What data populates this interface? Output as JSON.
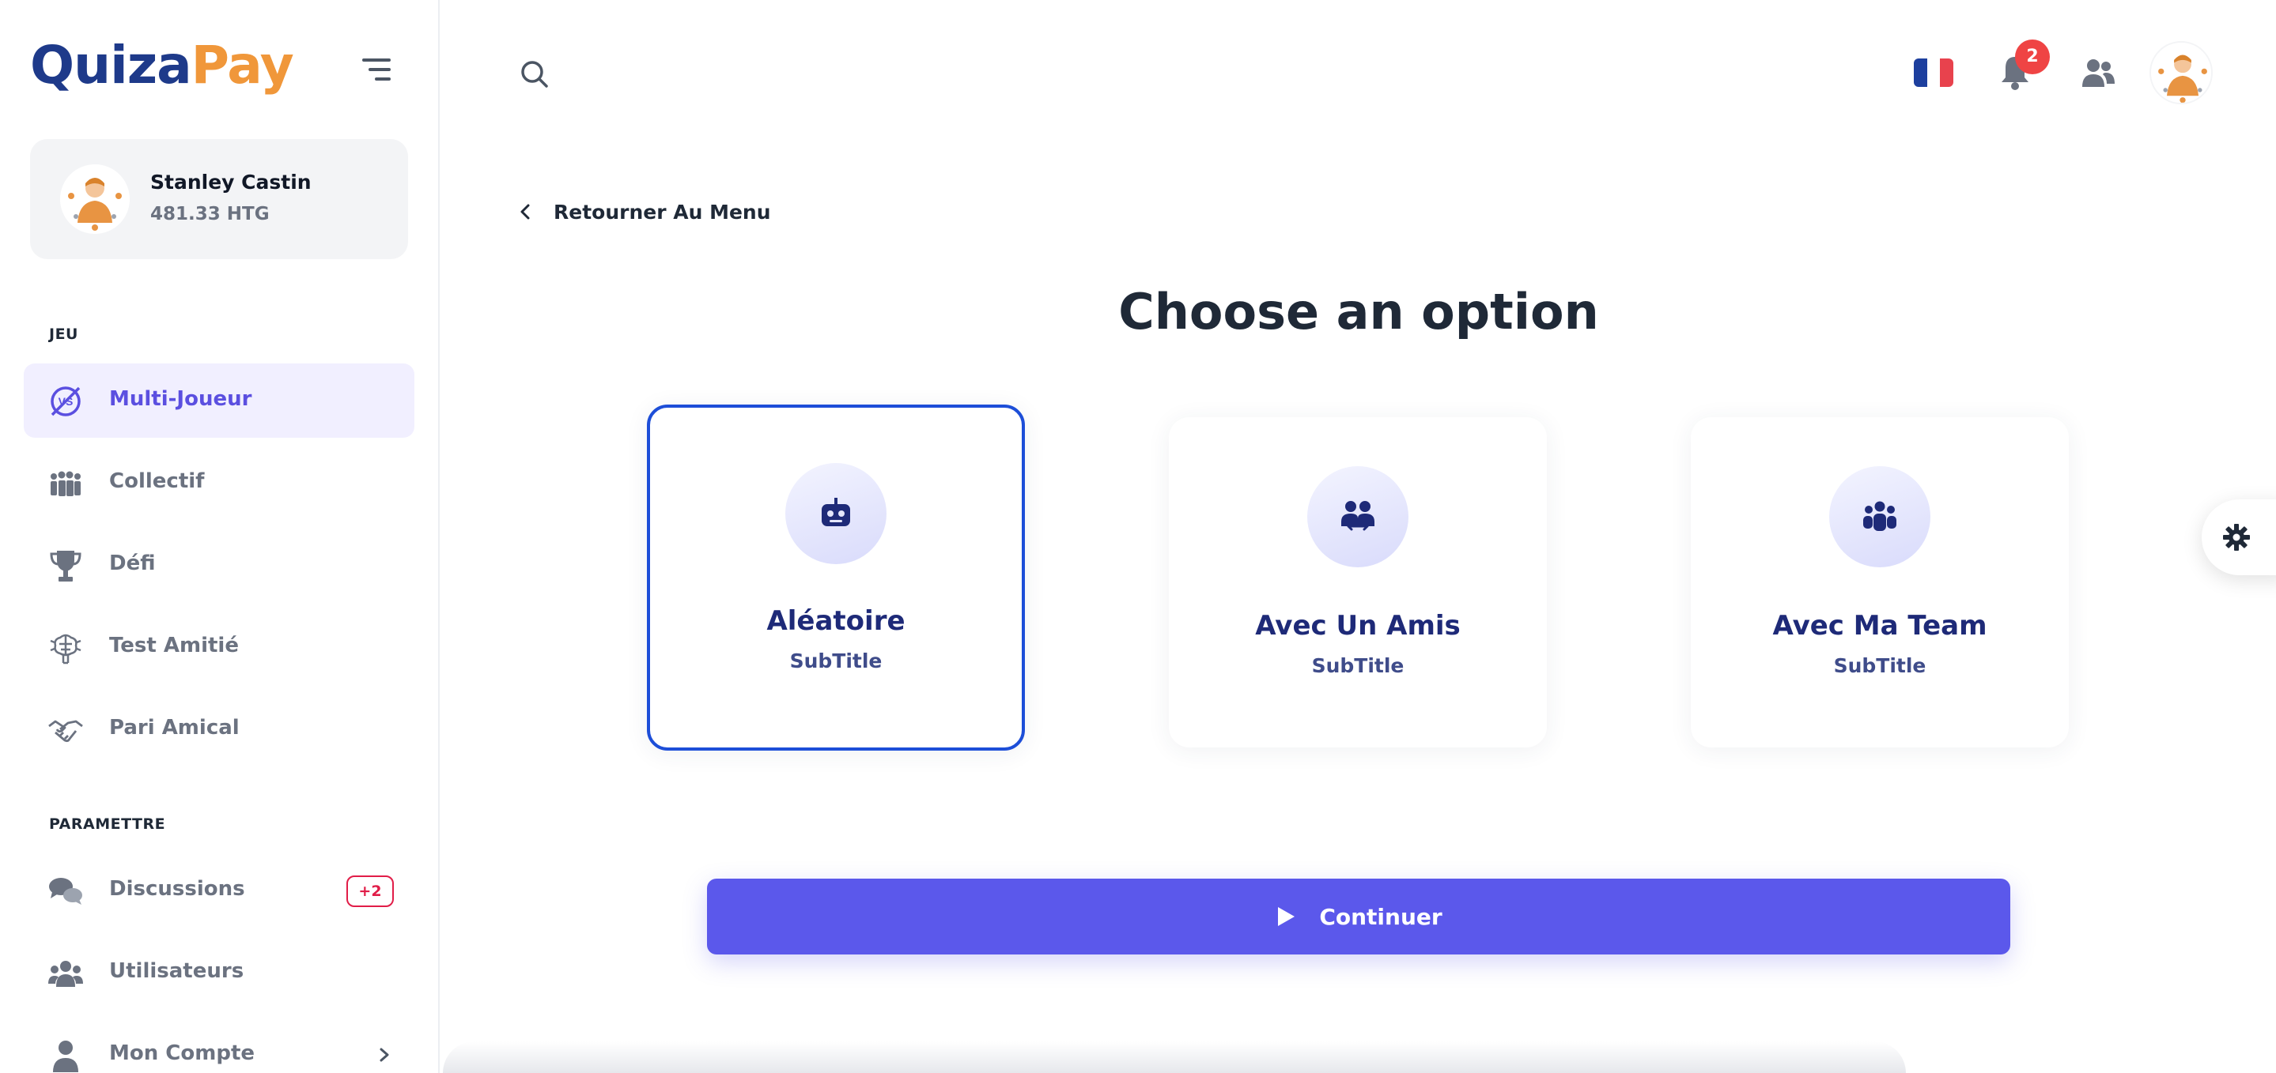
{
  "brand": {
    "logo_part1": "Quiza",
    "logo_part2": "Pay"
  },
  "profile": {
    "name": "Stanley Castin",
    "balance": "481.33 HTG"
  },
  "sidebar": {
    "section_game": "JEU",
    "game_items": [
      {
        "label": "Multi-Joueur",
        "icon": "vs-icon",
        "active": true
      },
      {
        "label": "Collectif",
        "icon": "group-icon"
      },
      {
        "label": "Défi",
        "icon": "trophy-icon"
      },
      {
        "label": "Test Amitié",
        "icon": "brain-icon"
      },
      {
        "label": "Pari Amical",
        "icon": "handshake-icon"
      }
    ],
    "section_settings": "PARAMETTRE",
    "settings_items": [
      {
        "label": "Discussions",
        "icon": "chat-icon",
        "badge": "+2"
      },
      {
        "label": "Utilisateurs",
        "icon": "users-icon"
      },
      {
        "label": "Mon Compte",
        "icon": "user-icon"
      }
    ]
  },
  "topbar": {
    "notification_count": "2",
    "language_flag": "fr"
  },
  "main": {
    "back_label": "Retourner Au Menu",
    "title": "Choose an option",
    "options": [
      {
        "title": "Aléatoire",
        "subtitle": "SubTitle",
        "icon": "robot-icon",
        "selected": true
      },
      {
        "title": "Avec Un Amis",
        "subtitle": "SubTitle",
        "icon": "friends-icon"
      },
      {
        "title": "Avec Ma Team",
        "subtitle": "SubTitle",
        "icon": "team-icon"
      }
    ],
    "continue_label": "Continuer"
  },
  "colors": {
    "accent": "#5b58eb",
    "brand_blue": "#1e3a8a",
    "brand_orange": "#f0973a",
    "selected_border": "#1d4ed8",
    "badge_red": "#ef4444"
  }
}
